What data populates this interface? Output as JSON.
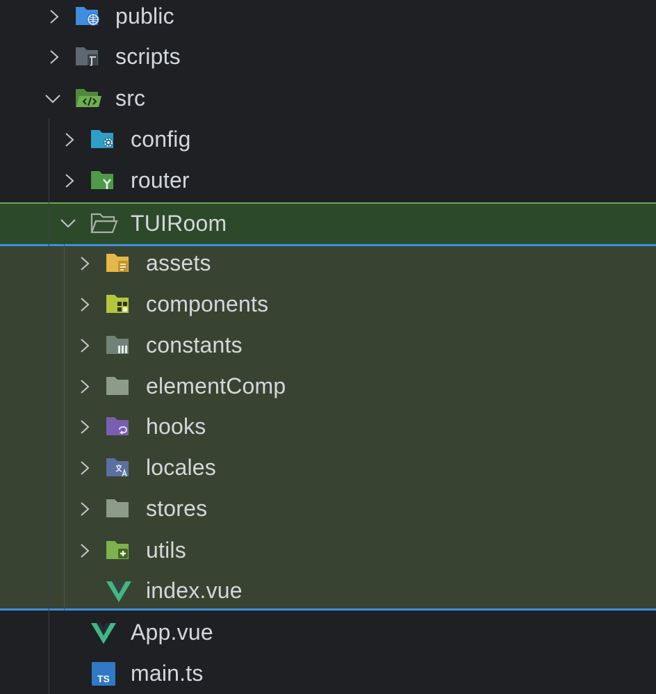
{
  "tree": {
    "items": [
      {
        "label": "public",
        "icon": "folder-public-icon",
        "expanded": false
      },
      {
        "label": "scripts",
        "icon": "folder-scripts-icon",
        "expanded": false
      },
      {
        "label": "src",
        "icon": "folder-src-icon",
        "expanded": true
      },
      {
        "label": "config",
        "icon": "folder-config-icon",
        "expanded": false
      },
      {
        "label": "router",
        "icon": "folder-router-icon",
        "expanded": false
      },
      {
        "label": "TUIRoom",
        "icon": "folder-open-icon",
        "expanded": true,
        "selected": true
      },
      {
        "label": "assets",
        "icon": "folder-assets-icon",
        "expanded": false
      },
      {
        "label": "components",
        "icon": "folder-components-icon",
        "expanded": false
      },
      {
        "label": "constants",
        "icon": "folder-constants-icon",
        "expanded": false
      },
      {
        "label": "elementComp",
        "icon": "folder-icon",
        "expanded": false
      },
      {
        "label": "hooks",
        "icon": "folder-hooks-icon",
        "expanded": false
      },
      {
        "label": "locales",
        "icon": "folder-locales-icon",
        "expanded": false
      },
      {
        "label": "stores",
        "icon": "folder-icon",
        "expanded": false
      },
      {
        "label": "utils",
        "icon": "folder-utils-icon",
        "expanded": false
      },
      {
        "label": "index.vue",
        "icon": "vue-file-icon"
      },
      {
        "label": "App.vue",
        "icon": "vue-file-icon"
      },
      {
        "label": "main.ts",
        "icon": "typescript-file-icon"
      }
    ]
  },
  "colors": {
    "background": "#1e2024",
    "selected_row": "#2c4a2a",
    "selected_children": "#384431",
    "focus_border": "#3b8fe0",
    "text": "#d4d7dc"
  }
}
